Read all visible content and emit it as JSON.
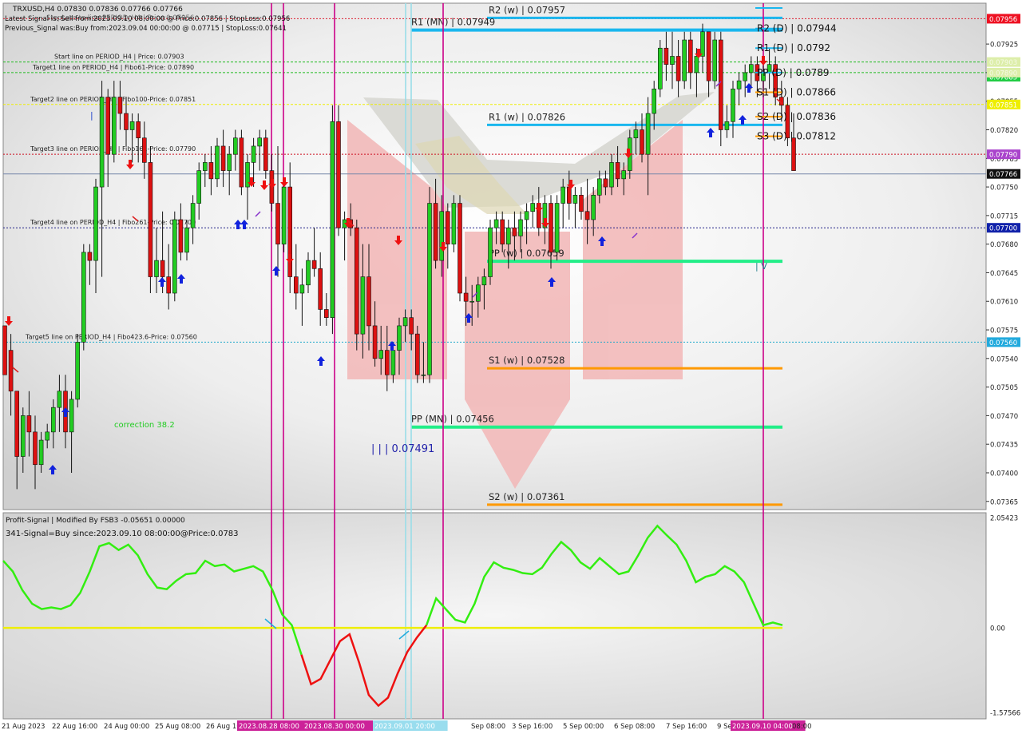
{
  "header": {
    "symbol_line": "TRXUSD,H4  0.07830 0.07836 0.07766 0.07766",
    "latest_signal": "Latest Signal is: Sell from:2023.09.10 08:00:00 @ Price:0.07856 | StopLoss:0.07956",
    "overlap_text": "StopLoss to line:PERIOD_H4 | Price:0.07956",
    "previous_signal": "Previous_Signal was:Buy from:2023.09.04 00:00:00 @ 0.07715 | StopLoss:0.07641"
  },
  "colors": {
    "up_candle": "#22cc22",
    "down_candle": "#dd1111",
    "pivot_blue": "#1ab7ee",
    "pivot_green": "#22ee88",
    "pivot_orange": "#ff9900",
    "vline_magenta": "#cc0088",
    "vline_cyan": "#99dde8",
    "osc_green": "#33ee11",
    "osc_red": "#ee1111",
    "osc_zero": "#eeee00"
  },
  "chart_data": [
    {
      "type": "candlestick",
      "symbol": "TRXUSD",
      "timeframe": "H4",
      "ylim": [
        0.07355,
        0.07975
      ],
      "y_ticks": [
        "0.07925",
        "0.07890",
        "0.07855",
        "0.07820",
        "0.07785",
        "0.07750",
        "0.07715",
        "0.07680",
        "0.07645",
        "0.07610",
        "0.07575",
        "0.07540",
        "0.07505",
        "0.07470",
        "0.07435",
        "0.07400",
        "0.07365"
      ],
      "candles": [
        [
          0.0758,
          0.0758,
          0.0752,
          0.0752
        ],
        [
          0.0755,
          0.0757,
          0.0747,
          0.075
        ],
        [
          0.075,
          0.075,
          0.0738,
          0.0742
        ],
        [
          0.0742,
          0.0748,
          0.074,
          0.0747
        ],
        [
          0.0747,
          0.075,
          0.0742,
          0.0745
        ],
        [
          0.0745,
          0.0747,
          0.0738,
          0.0741
        ],
        [
          0.0741,
          0.0745,
          0.074,
          0.0744
        ],
        [
          0.0744,
          0.0746,
          0.0743,
          0.0745
        ],
        [
          0.0745,
          0.0749,
          0.0743,
          0.0748
        ],
        [
          0.0748,
          0.0752,
          0.0745,
          0.075
        ],
        [
          0.075,
          0.0752,
          0.0743,
          0.0745
        ],
        [
          0.0745,
          0.075,
          0.074,
          0.0749
        ],
        [
          0.0749,
          0.0757,
          0.0748,
          0.0756
        ],
        [
          0.0756,
          0.0768,
          0.0755,
          0.0767
        ],
        [
          0.0767,
          0.0768,
          0.0763,
          0.0766
        ],
        [
          0.0766,
          0.0776,
          0.0762,
          0.0775
        ],
        [
          0.0775,
          0.0788,
          0.0764,
          0.0786
        ],
        [
          0.0786,
          0.0787,
          0.0775,
          0.0779
        ],
        [
          0.0779,
          0.0788,
          0.0778,
          0.0786
        ],
        [
          0.0786,
          0.0788,
          0.0782,
          0.0784
        ],
        [
          0.0784,
          0.0786,
          0.078,
          0.0782
        ],
        [
          0.0782,
          0.0784,
          0.0778,
          0.0783
        ],
        [
          0.0783,
          0.0784,
          0.0778,
          0.0781
        ],
        [
          0.0781,
          0.0783,
          0.0776,
          0.0778
        ],
        [
          0.0778,
          0.078,
          0.0762,
          0.0764
        ],
        [
          0.0764,
          0.077,
          0.0762,
          0.0766
        ],
        [
          0.0766,
          0.0772,
          0.0762,
          0.0764
        ],
        [
          0.0764,
          0.0768,
          0.076,
          0.0762
        ],
        [
          0.0762,
          0.0772,
          0.0761,
          0.0771
        ],
        [
          0.0771,
          0.0773,
          0.0766,
          0.0767
        ],
        [
          0.0767,
          0.0771,
          0.0766,
          0.077
        ],
        [
          0.077,
          0.0774,
          0.0768,
          0.0773
        ],
        [
          0.0773,
          0.0778,
          0.0771,
          0.0777
        ],
        [
          0.0777,
          0.0779,
          0.0775,
          0.0778
        ],
        [
          0.0778,
          0.078,
          0.0774,
          0.0776
        ],
        [
          0.0776,
          0.0781,
          0.0775,
          0.078
        ],
        [
          0.078,
          0.0782,
          0.0775,
          0.0777
        ],
        [
          0.0777,
          0.078,
          0.0774,
          0.0779
        ],
        [
          0.0779,
          0.0782,
          0.0777,
          0.0781
        ],
        [
          0.0781,
          0.0782,
          0.0774,
          0.0775
        ],
        [
          0.0775,
          0.0779,
          0.0771,
          0.0778
        ],
        [
          0.0778,
          0.0781,
          0.0775,
          0.078
        ],
        [
          0.078,
          0.0782,
          0.0777,
          0.0781
        ],
        [
          0.0781,
          0.0782,
          0.0776,
          0.0777
        ],
        [
          0.0777,
          0.0779,
          0.0772,
          0.0773
        ],
        [
          0.0773,
          0.078,
          0.0764,
          0.0768
        ],
        [
          0.0768,
          0.0776,
          0.0767,
          0.0775
        ],
        [
          0.0775,
          0.0778,
          0.0762,
          0.0764
        ],
        [
          0.0764,
          0.0768,
          0.076,
          0.0762
        ],
        [
          0.0762,
          0.0765,
          0.0758,
          0.0763
        ],
        [
          0.0763,
          0.0767,
          0.0762,
          0.0766
        ],
        [
          0.0766,
          0.077,
          0.0764,
          0.0765
        ],
        [
          0.0765,
          0.0767,
          0.0758,
          0.076
        ],
        [
          0.076,
          0.0762,
          0.0758,
          0.0759
        ],
        [
          0.0759,
          0.0785,
          0.0757,
          0.0783
        ],
        [
          0.0783,
          0.0785,
          0.0769,
          0.077
        ],
        [
          0.077,
          0.0772,
          0.0766,
          0.0771
        ],
        [
          0.0771,
          0.0773,
          0.0769,
          0.077
        ],
        [
          0.077,
          0.0771,
          0.0755,
          0.0757
        ],
        [
          0.0757,
          0.0768,
          0.0754,
          0.0764
        ],
        [
          0.0764,
          0.0768,
          0.0755,
          0.0758
        ],
        [
          0.0758,
          0.0761,
          0.0753,
          0.0754
        ],
        [
          0.0754,
          0.0758,
          0.0752,
          0.0755
        ],
        [
          0.0755,
          0.0758,
          0.075,
          0.0752
        ],
        [
          0.0752,
          0.0756,
          0.0751,
          0.0755
        ],
        [
          0.0755,
          0.0759,
          0.0752,
          0.0758
        ],
        [
          0.0758,
          0.076,
          0.0756,
          0.0759
        ],
        [
          0.0759,
          0.076,
          0.0755,
          0.0757
        ],
        [
          0.0757,
          0.0758,
          0.0751,
          0.0752
        ],
        [
          0.0752,
          0.0756,
          0.0751,
          0.0752
        ],
        [
          0.0752,
          0.0775,
          0.0751,
          0.0773
        ],
        [
          0.0773,
          0.0776,
          0.0765,
          0.0766
        ],
        [
          0.0766,
          0.0774,
          0.0764,
          0.0772
        ],
        [
          0.0772,
          0.0773,
          0.0765,
          0.0768
        ],
        [
          0.0768,
          0.0774,
          0.0767,
          0.0773
        ],
        [
          0.0773,
          0.0774,
          0.0761,
          0.0762
        ],
        [
          0.0762,
          0.0764,
          0.0758,
          0.0761
        ],
        [
          0.0761,
          0.0763,
          0.0758,
          0.0761
        ],
        [
          0.0761,
          0.0764,
          0.0759,
          0.0763
        ],
        [
          0.0763,
          0.0765,
          0.076,
          0.0764
        ],
        [
          0.0764,
          0.0771,
          0.0763,
          0.077
        ],
        [
          0.077,
          0.0772,
          0.0768,
          0.0771
        ],
        [
          0.0771,
          0.0772,
          0.0767,
          0.0768
        ],
        [
          0.0768,
          0.0771,
          0.0765,
          0.077
        ],
        [
          0.077,
          0.0772,
          0.0766,
          0.0769
        ],
        [
          0.0769,
          0.0772,
          0.0767,
          0.0771
        ],
        [
          0.0771,
          0.0773,
          0.0768,
          0.0772
        ],
        [
          0.0772,
          0.0774,
          0.077,
          0.0773
        ],
        [
          0.0773,
          0.0775,
          0.0769,
          0.077
        ],
        [
          0.077,
          0.0774,
          0.0768,
          0.0773
        ],
        [
          0.0773,
          0.0774,
          0.0765,
          0.0767
        ],
        [
          0.0767,
          0.0774,
          0.0766,
          0.0773
        ],
        [
          0.0773,
          0.0776,
          0.077,
          0.0775
        ],
        [
          0.0775,
          0.0777,
          0.0771,
          0.0773
        ],
        [
          0.0773,
          0.0775,
          0.077,
          0.0774
        ],
        [
          0.0774,
          0.0775,
          0.0771,
          0.0772
        ],
        [
          0.0772,
          0.0776,
          0.0768,
          0.0771
        ],
        [
          0.0771,
          0.0775,
          0.0769,
          0.0774
        ],
        [
          0.0774,
          0.0777,
          0.0773,
          0.0776
        ],
        [
          0.0776,
          0.0777,
          0.0774,
          0.0775
        ],
        [
          0.0775,
          0.0779,
          0.0774,
          0.0778
        ],
        [
          0.0778,
          0.078,
          0.0775,
          0.0776
        ],
        [
          0.0776,
          0.0778,
          0.0774,
          0.0777
        ],
        [
          0.0777,
          0.0782,
          0.0776,
          0.0781
        ],
        [
          0.0781,
          0.0783,
          0.0779,
          0.0782
        ],
        [
          0.0782,
          0.0784,
          0.0778,
          0.0779
        ],
        [
          0.0779,
          0.0786,
          0.0774,
          0.0784
        ],
        [
          0.0784,
          0.0788,
          0.0782,
          0.0787
        ],
        [
          0.0787,
          0.0793,
          0.0786,
          0.0792
        ],
        [
          0.0792,
          0.0794,
          0.0788,
          0.079
        ],
        [
          0.079,
          0.0794,
          0.0787,
          0.0791
        ],
        [
          0.0791,
          0.0793,
          0.0786,
          0.0788
        ],
        [
          0.0788,
          0.0794,
          0.0787,
          0.0793
        ],
        [
          0.0793,
          0.0794,
          0.0787,
          0.0789
        ],
        [
          0.0789,
          0.0792,
          0.0786,
          0.0791
        ],
        [
          0.0791,
          0.0795,
          0.0789,
          0.0794
        ],
        [
          0.0794,
          0.0794,
          0.0786,
          0.0788
        ],
        [
          0.0788,
          0.0794,
          0.0787,
          0.0793
        ],
        [
          0.0793,
          0.0794,
          0.078,
          0.0782
        ],
        [
          0.0782,
          0.0785,
          0.0781,
          0.0783
        ],
        [
          0.0783,
          0.0788,
          0.0781,
          0.0787
        ],
        [
          0.0787,
          0.0789,
          0.0785,
          0.0788
        ],
        [
          0.0788,
          0.079,
          0.0786,
          0.0789
        ],
        [
          0.0789,
          0.0791,
          0.0787,
          0.079
        ],
        [
          0.079,
          0.0791,
          0.0786,
          0.0788
        ],
        [
          0.0788,
          0.079,
          0.0786,
          0.0789
        ],
        [
          0.0789,
          0.0792,
          0.0787,
          0.079
        ],
        [
          0.079,
          0.0791,
          0.0785,
          0.0786
        ],
        [
          0.0786,
          0.0788,
          0.0783,
          0.0785
        ],
        [
          0.0785,
          0.0786,
          0.078,
          0.0781
        ],
        [
          0.0781,
          0.0784,
          0.0777,
          0.0777
        ]
      ],
      "price_tags": [
        "0.07956",
        "0.07885",
        "0.07851",
        "0.07790",
        "0.07766",
        "0.07700",
        "0.07560"
      ],
      "price_tags_obscured": [
        "0.07903",
        "0.07890"
      ],
      "horizontal_lines": [
        {
          "label": "Start line on PERIOD_H4 | Price: 0.07903",
          "price": 0.07903
        },
        {
          "label": "Target1 line on PERIOD_H4 | Fibo61-Price: 0.07890",
          "price": 0.0789
        },
        {
          "label": "Target2 line on PERIOD_H4 | Fibo100-Price: 0.07851",
          "price": 0.07851
        },
        {
          "label": "Target3 line on PERIOD_H4 | Fibo161-Price: 0.07790",
          "price": 0.0779
        },
        {
          "label": "Target4 line on PERIOD_H4 | Fibo261-Price: 0.07700",
          "price": 0.077
        },
        {
          "label": "Target5 line on PERIOD_H4 | Fibo423.6-Price: 0.07560",
          "price": 0.0756
        },
        {
          "label": "",
          "price": 0.07956
        },
        {
          "label": "",
          "price": 0.07766
        }
      ],
      "pivot_levels": [
        {
          "label": "R2 (w) | 0.07957",
          "price": 0.07957
        },
        {
          "label": "R1 (MN) | 0.07949",
          "price": 0.07949
        },
        {
          "label": "R1 (w) | 0.07826",
          "price": 0.07826
        },
        {
          "label": "PP (w) | 0.07659",
          "price": 0.07659
        },
        {
          "label": "S1 (w) | 0.07528",
          "price": 0.07528
        },
        {
          "label": "PP (MN) | 0.07456",
          "price": 0.07456
        },
        {
          "label": "S2 (w) | 0.07361",
          "price": 0.07361
        }
      ],
      "daily_levels": [
        {
          "label": "R2 (D) | 0.07944",
          "price": 0.07944
        },
        {
          "label": "R1 (D) | 0.0792",
          "price": 0.0792
        },
        {
          "label": "PP (D) | 0.0789",
          "price": 0.0789
        },
        {
          "label": "S1 (D) | 0.07866",
          "price": 0.07866
        },
        {
          "label": "S2 (D) | 0.07836",
          "price": 0.07836
        },
        {
          "label": "S3 (D) | 0.07812",
          "price": 0.07812
        }
      ],
      "annotations": [
        "correction 38.2",
        "| | | 0.07491",
        "| V"
      ]
    },
    {
      "type": "line",
      "title": "Profit-Signal | Modified By FSB3 -0.05651 0.00000",
      "subtitle": "341-Signal=Buy since:2023.09.10 08:00:00@Price:0.0783",
      "ylim": [
        -1.57566,
        2.05423
      ],
      "y_ticks": [
        "2.05423",
        "0.00",
        "-1.57566"
      ],
      "series": [
        {
          "values": [
            1.25,
            1.05,
            0.7,
            0.45,
            0.35,
            0.38,
            0.35,
            0.42,
            0.65,
            1.05,
            1.52,
            1.58,
            1.45,
            1.55,
            1.35,
            1.0,
            0.75,
            0.72,
            0.88,
            1.0,
            1.02,
            1.25,
            1.15,
            1.18,
            1.05,
            1.1,
            1.15,
            1.05,
            0.7,
            0.25,
            0.05,
            -0.5,
            -1.05,
            -0.95,
            -0.6,
            -0.25,
            -0.12,
            -0.65,
            -1.25,
            -1.45,
            -1.3,
            -0.85,
            -0.45,
            -0.18,
            0.05,
            0.55,
            0.35,
            0.15,
            0.1,
            0.45,
            0.95,
            1.22,
            1.12,
            1.08,
            1.02,
            1.0,
            1.12,
            1.38,
            1.6,
            1.45,
            1.22,
            1.1,
            1.3,
            1.15,
            1.0,
            1.05,
            1.35,
            1.68,
            1.9,
            1.72,
            1.55,
            1.25,
            0.85,
            0.95,
            1.0,
            1.15,
            1.05,
            0.85,
            0.45,
            0.05,
            0.1,
            0.05
          ]
        }
      ],
      "zero_line": 0.0
    }
  ],
  "x_axis": {
    "labels": [
      "21 Aug 2023",
      "22 Aug 16:00",
      "24 Aug 00:00",
      "25 Aug 08:00",
      "26 Aug 16:00",
      "2023.08.28 08:00",
      "2023.08.30 00:00",
      "2023.09.01 20:00",
      "Sep 08:00",
      "3 Sep 16:00",
      "5 Sep 00:00",
      "6 Sep 08:00",
      "7 Sep 16:00",
      "9 Se",
      "2023.09.10 04:00",
      "08:00"
    ],
    "highlighted": [
      "2023.08.28 08:00",
      "2023.08.30 00:00",
      "2023.09.01 20:00",
      "2023.09.10 04:00"
    ]
  }
}
